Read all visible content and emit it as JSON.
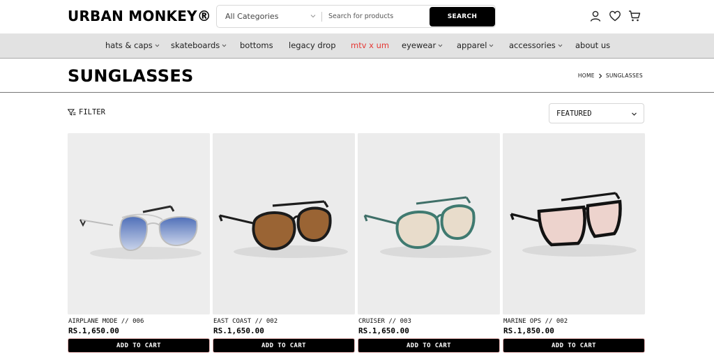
{
  "header": {
    "logo": "URBAN MONKEY®",
    "category_select": "All Categories",
    "search_placeholder": "Search for products",
    "search_button": "SEARCH",
    "icons": [
      "user-icon",
      "heart-icon",
      "cart-icon"
    ]
  },
  "nav": {
    "items": [
      {
        "label": "hats & caps",
        "dropdown": true
      },
      {
        "label": "skateboards",
        "dropdown": true
      },
      {
        "label": "bottoms",
        "dropdown": false
      },
      {
        "label": "legacy drop",
        "dropdown": false
      },
      {
        "label": "mtv x um",
        "dropdown": false,
        "color": "#e53935"
      },
      {
        "label": "eyewear",
        "dropdown": true
      },
      {
        "label": "apparel",
        "dropdown": true
      },
      {
        "label": "accessories",
        "dropdown": true
      },
      {
        "label": "about us",
        "dropdown": false
      }
    ]
  },
  "page": {
    "title": "SUNGLASSES",
    "breadcrumb": [
      "HOME",
      "SUNGLASSES"
    ]
  },
  "toolbar": {
    "filter_label": "FILTER",
    "sort_value": "FEATURED"
  },
  "products": [
    {
      "name": "AIRPLANE MODE // 006",
      "price": "RS.1,650.00",
      "button": "ADD TO CART",
      "frame": "silver-metal",
      "lens": "blue-gradient"
    },
    {
      "name": "EAST COAST // 002",
      "price": "RS.1,650.00",
      "button": "ADD TO CART",
      "frame": "black",
      "lens": "brown"
    },
    {
      "name": "CRUISER // 003",
      "price": "RS.1,650.00",
      "button": "ADD TO CART",
      "frame": "teal-green",
      "lens": "clear-pink"
    },
    {
      "name": "MARINE OPS // 002",
      "price": "RS.1,850.00",
      "button": "ADD TO CART",
      "frame": "black",
      "lens": "light-pink"
    }
  ],
  "colors": {
    "accent": "#000000",
    "nav_bg": "#e2e2e2",
    "highlight_nav": "#e53935",
    "card_bg": "#ececec"
  }
}
